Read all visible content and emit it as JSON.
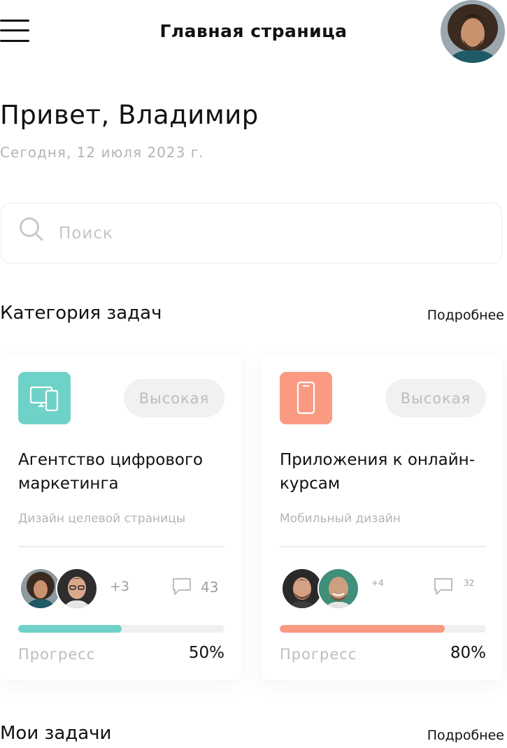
{
  "header": {
    "title": "Главная страница"
  },
  "greeting": {
    "text": "Привет, Владимир",
    "date": "Сегодня, 12 июля 2023 г."
  },
  "search": {
    "placeholder": "Поиск"
  },
  "categories_section": {
    "title": "Категория задач",
    "more": "Подробнее"
  },
  "cards": [
    {
      "icon": "devices-icon",
      "icon_color": "#6fd2c8",
      "priority": "Высокая",
      "title": "Агентство цифрового маркетинга",
      "subtitle": "Дизайн целевой страницы",
      "extra_members": "+3",
      "comments": "43",
      "progress_label": "Прогресс",
      "progress": 50,
      "progress_text": "50%",
      "accent": "#6fd2c8"
    },
    {
      "icon": "smartphone-icon",
      "icon_color": "#fb9a83",
      "priority": "Высокая",
      "title": "Приложения к онлайн-курсам",
      "subtitle": "Мобильный дизайн",
      "extra_members": "+4",
      "comments": "32",
      "progress_label": "Прогресс",
      "progress": 80,
      "progress_text": "80%",
      "accent": "#fb9a83"
    }
  ],
  "my_tasks_section": {
    "title": "Мои задачи",
    "more": "Подробнее"
  }
}
